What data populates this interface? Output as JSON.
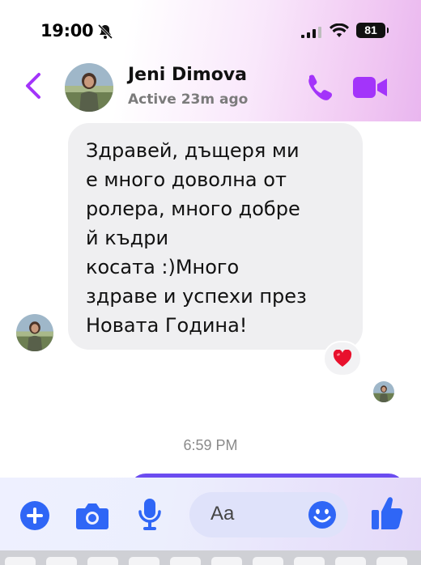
{
  "status_bar": {
    "time": "19:00",
    "battery": "81",
    "icons": [
      "bell-slash-icon",
      "cellular-signal-icon",
      "wifi-icon",
      "battery-icon"
    ]
  },
  "header": {
    "contact_name": "Jeni Dimova",
    "contact_status": "Active 23m ago",
    "icons": [
      "back-chevron-icon",
      "phone-icon",
      "video-camera-icon"
    ]
  },
  "messages": [
    {
      "from": "Jeni Dimova",
      "text": "Здравей, дъщеря ми\nе много доволна от\nролера, много добре\nй къдри\nкосата :)Много\nздраве и успехи през\nНовата Година!",
      "reaction": "❤️"
    }
  ],
  "timestamp": "6:59 PM",
  "composer": {
    "placeholder": "Aa",
    "icons": [
      "plus-circle-icon",
      "camera-icon",
      "microphone-icon",
      "emoji-icon",
      "thumbs-up-icon"
    ]
  },
  "colors": {
    "accent": "#a334fa",
    "composer_icon": "#2f66f6",
    "bubble": "#efeff1"
  }
}
